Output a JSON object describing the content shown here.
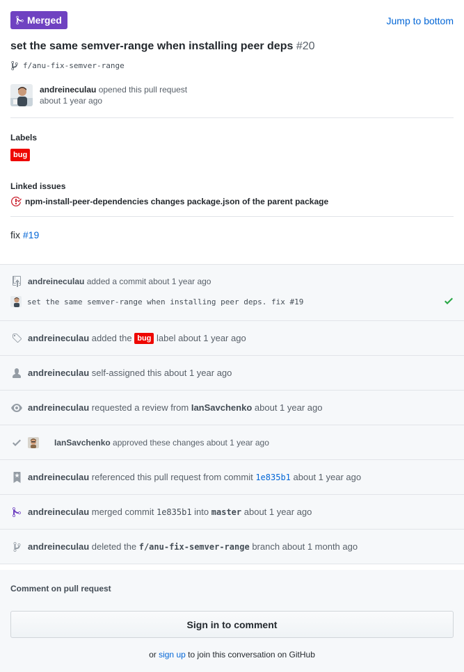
{
  "header": {
    "state": "Merged",
    "jump_link": "Jump to bottom",
    "title": "set the same semver-range when installing peer deps",
    "number": "#20",
    "branch": "f/anu-fix-semver-range",
    "author": "andreineculau",
    "opened_text": "opened this pull request",
    "opened_time": "about 1 year ago"
  },
  "labels": {
    "heading": "Labels",
    "items": [
      "bug"
    ]
  },
  "linked_issues": {
    "heading": "Linked issues",
    "items": [
      "npm-install-peer-dependencies changes package.json of the parent package"
    ]
  },
  "body": {
    "text": "fix",
    "link": "#19"
  },
  "timeline": {
    "commit": {
      "user": "andreineculau",
      "action": "added a commit about 1 year ago",
      "message": "set the same semver-range when installing peer deps. fix #19"
    },
    "label_added": {
      "user": "andreineculau",
      "before": "added the",
      "label": "bug",
      "after": "label about 1 year ago"
    },
    "self_assigned": {
      "user": "andreineculau",
      "text": "self-assigned this about 1 year ago"
    },
    "review_requested": {
      "user": "andreineculau",
      "text": "requested a review from",
      "reviewer": "IanSavchenko",
      "time": "about 1 year ago"
    },
    "approved": {
      "user": "IanSavchenko",
      "text": "approved these changes about 1 year ago"
    },
    "referenced": {
      "user": "andreineculau",
      "text": "referenced this pull request from commit",
      "sha": "1e835b1",
      "time": "about 1 year ago"
    },
    "merged": {
      "user": "andreineculau",
      "text": "merged commit",
      "sha": "1e835b1",
      "into": "into",
      "branch": "master",
      "time": "about 1 year ago"
    },
    "deleted": {
      "user": "andreineculau",
      "text": "deleted the",
      "branch": "f/anu-fix-semver-range",
      "after": "branch about 1 month ago"
    }
  },
  "comment": {
    "heading": "Comment on pull request",
    "signin_button": "Sign in to comment",
    "or": "or",
    "signup": "sign up",
    "tail": "to join this conversation on GitHub"
  },
  "colors": {
    "merged": "#6f42c1",
    "bug_label": "#ee0701",
    "link": "#0366d6",
    "check": "#28a745"
  }
}
